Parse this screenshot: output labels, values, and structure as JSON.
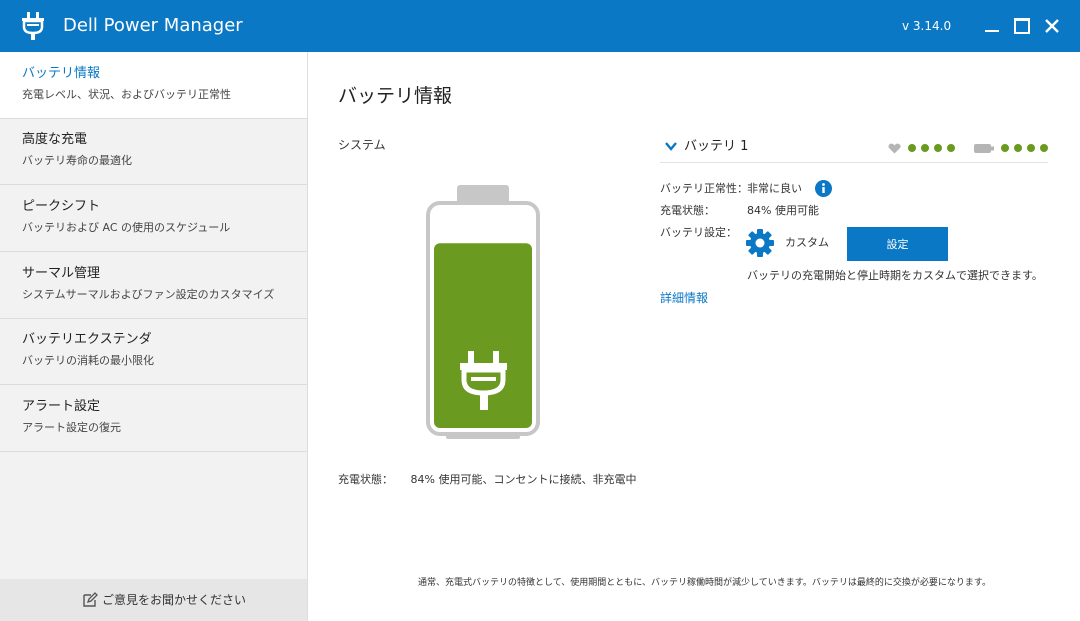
{
  "app": {
    "title": "Dell Power Manager",
    "version": "v 3.14.0"
  },
  "sidebar": {
    "items": [
      {
        "title": "バッテリ情報",
        "desc": "充電レベル、状況、およびバッテリ正常性"
      },
      {
        "title": "高度な充電",
        "desc": "バッテリ寿命の最適化"
      },
      {
        "title": "ピークシフト",
        "desc": "バッテリおよび AC の使用のスケジュール"
      },
      {
        "title": "サーマル管理",
        "desc": "システムサーマルおよびファン設定のカスタマイズ"
      },
      {
        "title": "バッテリエクステンダ",
        "desc": "バッテリの消耗の最小限化"
      },
      {
        "title": "アラート設定",
        "desc": "アラート設定の復元"
      }
    ],
    "feedback_label": "ご意見をお聞かせください"
  },
  "main": {
    "title": "バッテリ情報",
    "system_label": "システム",
    "charge_level_fraction": 0.84,
    "status_key": "充電状態：",
    "status_value": "84% 使用可能、コンセントに接続、非充電中",
    "footnote": "通常、充電式バッテリの特徴として、使用期間とともに、バッテリ稼働時間が減少していきます。バッテリは最終的に交換が必要になります。"
  },
  "battery_panel": {
    "name": "バッテリ 1",
    "health_dots": 4,
    "charge_dots": 4,
    "health_key": "バッテリ正常性：",
    "health_value": "非常に良い",
    "charge_key": "充電状態：",
    "charge_value": "84% 使用可能",
    "settings_key": "バッテリ設定：",
    "settings_mode": "カスタム",
    "settings_button": "設定",
    "settings_desc": "バッテリの充電開始と停止時期をカスタムで選択できます。",
    "detail_link": "詳細情報"
  },
  "colors": {
    "brand_blue": "#0a78c4",
    "charge_green": "#6a9a1f",
    "sidebar_bg": "#f2f2f2"
  },
  "icons": [
    "plug-icon",
    "minimize-icon",
    "maximize-icon",
    "close-icon",
    "edit-icon",
    "chevron-down-icon",
    "heart-icon",
    "battery-icon",
    "info-icon",
    "gear-icon"
  ]
}
